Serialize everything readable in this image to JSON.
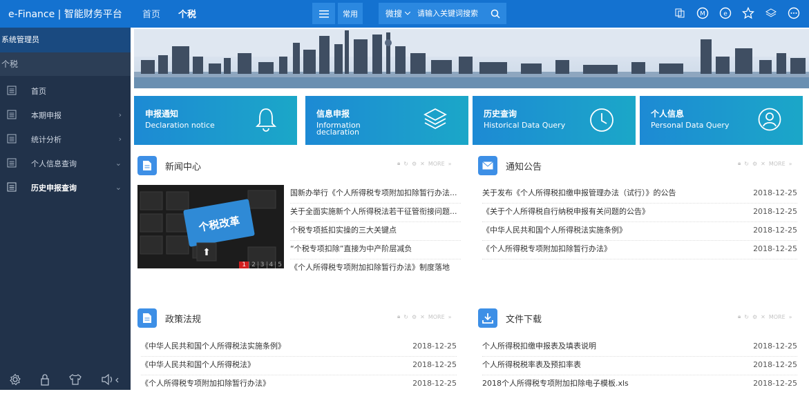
{
  "header": {
    "brand": "e-Finance | 智能财务平台",
    "nav": [
      "首页",
      "个税"
    ],
    "common_label": "常用",
    "search_mode": "微搜",
    "search_placeholder": "请输入关键词搜索"
  },
  "sidebar": {
    "user": "系统管理员",
    "section": "个税",
    "items": [
      {
        "label": "首页",
        "arrow": ""
      },
      {
        "label": "本期申报",
        "arrow": "›"
      },
      {
        "label": "统计分析",
        "arrow": "›"
      },
      {
        "label": "个人信息查询",
        "arrow": "⌄"
      },
      {
        "label": "历史申报查询",
        "arrow": "⌄"
      }
    ]
  },
  "cards": [
    {
      "title": "申报通知",
      "subtitle": "Declaration notice"
    },
    {
      "title": "信息申报",
      "subtitle": "Information declaration"
    },
    {
      "title": "历史查询",
      "subtitle": "Historical Data Query"
    },
    {
      "title": "个人信息",
      "subtitle": "Personal Data Query"
    }
  ],
  "panels": {
    "news": {
      "title": "新闻中心",
      "more": "MORE",
      "image_text": "个税改革",
      "image_pages": [
        "1",
        "2",
        "3",
        "4",
        "5"
      ],
      "items": [
        "国新办举行《个人所得税专项附加扣除暂行办法...",
        "关于全面实施新个人所得税法若干征管衔接问题...",
        "个税专项抵扣实操的三大关键点",
        "“个税专项扣除”直接为中产阶层减负",
        "《个人所得税专项附加扣除暂行办法》制度落地"
      ]
    },
    "notice": {
      "title": "通知公告",
      "more": "MORE",
      "items": [
        {
          "text": "关于发布《个人所得税扣缴申报管理办法（试行）》的公告",
          "date": "2018-12-25"
        },
        {
          "text": "《关于个人所得税自行纳税申报有关问题的公告》",
          "date": "2018-12-25"
        },
        {
          "text": "《中华人民共和国个人所得税法实施条例》",
          "date": "2018-12-25"
        },
        {
          "text": "《个人所得税专项附加扣除暂行办法》",
          "date": "2018-12-25"
        }
      ]
    },
    "policy": {
      "title": "政策法规",
      "more": "MORE",
      "items": [
        {
          "text": "《中华人民共和国个人所得税法实施条例》",
          "date": "2018-12-25"
        },
        {
          "text": "《中华人民共和国个人所得税法》",
          "date": "2018-12-25"
        },
        {
          "text": "《个人所得税专项附加扣除暂行办法》",
          "date": "2018-12-25"
        }
      ]
    },
    "download": {
      "title": "文件下载",
      "more": "MORE",
      "items": [
        {
          "text": "个人所得税扣缴申报表及填表说明",
          "date": "2018-12-25"
        },
        {
          "text": "个人所得税税率表及预扣率表",
          "date": "2018-12-25"
        },
        {
          "text": "2018个人所得税专项附加扣除电子模板.xls",
          "date": "2018-12-25"
        }
      ]
    }
  },
  "colors": {
    "topbar": "#1472d0",
    "sidebar": "#21324a",
    "card": "#1d8ad4"
  }
}
